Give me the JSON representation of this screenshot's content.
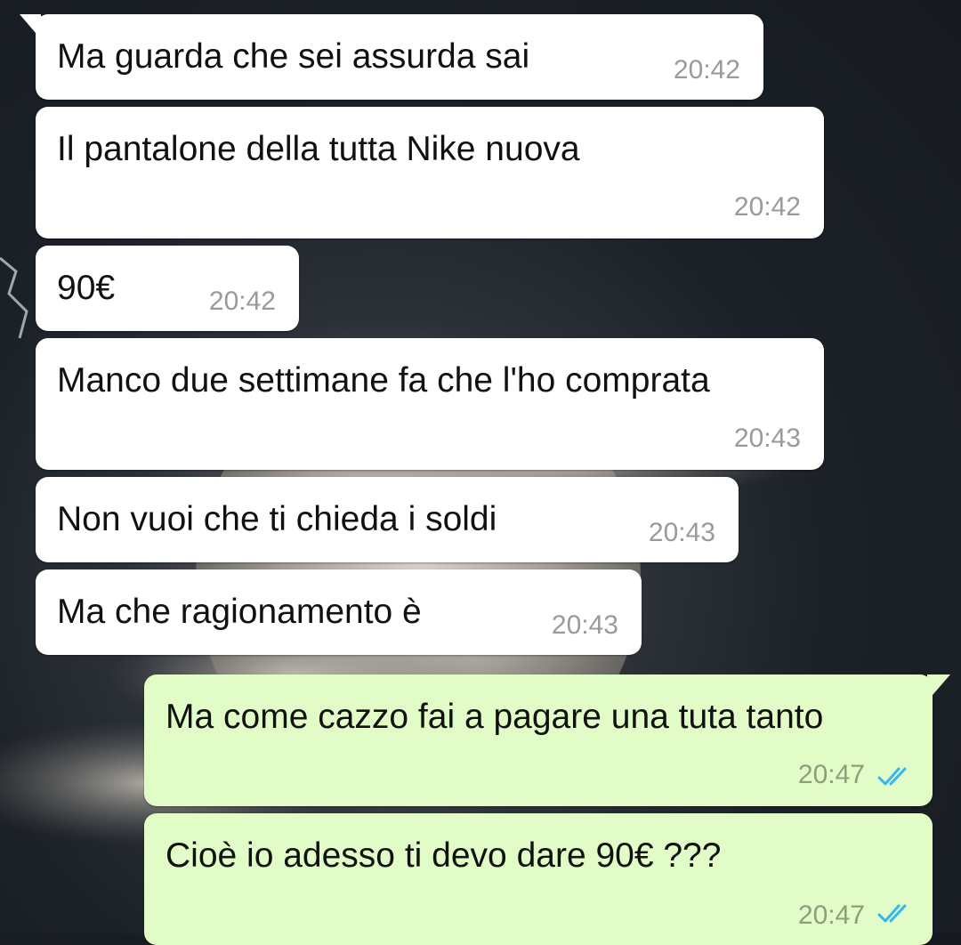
{
  "colors": {
    "incoming_bubble": "#ffffff",
    "outgoing_bubble": "#e2fcc7",
    "timestamp": "#9a9a9a",
    "read_check": "#34b7f1"
  },
  "messages": [
    {
      "direction": "incoming",
      "text": "Ma guarda che sei assurda sai",
      "time": "20:42"
    },
    {
      "direction": "incoming",
      "text": "Il pantalone della tutta Nike nuova",
      "time": "20:42"
    },
    {
      "direction": "incoming",
      "text": "90€",
      "time": "20:42"
    },
    {
      "direction": "incoming",
      "text": "Manco due settimane fa che l'ho comprata",
      "time": "20:43"
    },
    {
      "direction": "incoming",
      "text": "Non vuoi che ti chieda i soldi",
      "time": "20:43"
    },
    {
      "direction": "incoming",
      "text": "Ma che ragionamento è",
      "time": "20:43"
    },
    {
      "direction": "outgoing",
      "text": "Ma come cazzo fai a pagare una tuta tanto",
      "time": "20:47",
      "status_icon": "double-check-icon"
    },
    {
      "direction": "outgoing",
      "text": "Cioè io adesso ti devo dare 90€ ???",
      "time": "20:47",
      "status_icon": "double-check-icon"
    }
  ]
}
